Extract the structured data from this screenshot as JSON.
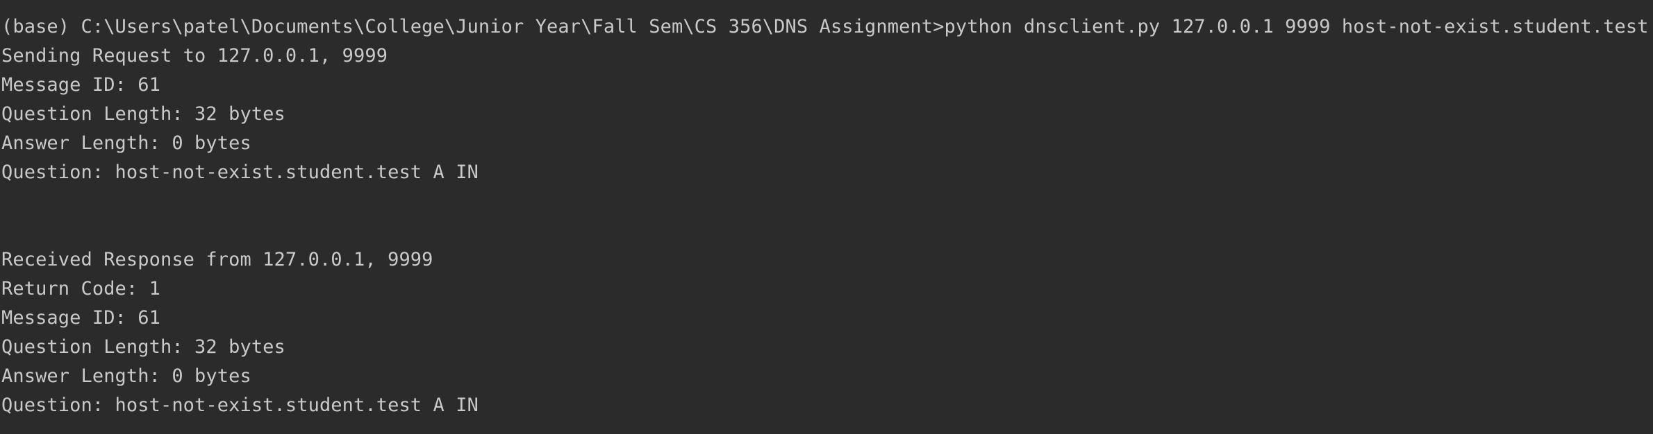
{
  "terminal": {
    "command_line": "(base) C:\\Users\\patel\\Documents\\College\\Junior Year\\Fall Sem\\CS 356\\DNS Assignment>python dnsclient.py 127.0.0.1 9999 host-not-exist.student.test",
    "request": {
      "sending": "Sending Request to 127.0.0.1, 9999",
      "message_id": "Message ID: 61",
      "question_length": "Question Length: 32 bytes",
      "answer_length": "Answer Length: 0 bytes",
      "question": "Question: host-not-exist.student.test A IN"
    },
    "response": {
      "received": "Received Response from 127.0.0.1, 9999",
      "return_code": "Return Code: 1",
      "message_id": "Message ID: 61",
      "question_length": "Question Length: 32 bytes",
      "answer_length": "Answer Length: 0 bytes",
      "question": "Question: host-not-exist.student.test A IN"
    }
  }
}
